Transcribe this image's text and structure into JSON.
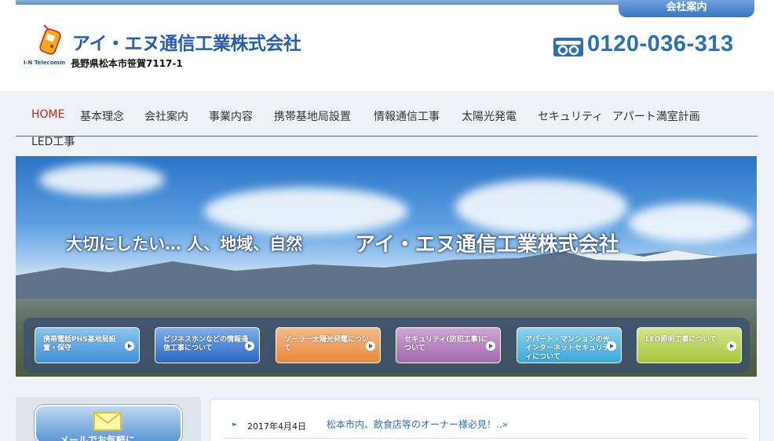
{
  "header": {
    "company_tab": "会社案内",
    "company_name": "アイ・エヌ通信工業株式会社",
    "brand_small": "I-N Telecomm",
    "address": "長野県松本市笹賀7117-1",
    "phone": "0120-036-313"
  },
  "nav": {
    "items": [
      "HOME",
      "基本理念",
      "会社案内",
      "事業内容",
      "携帯基地局設置",
      "情報通信工事",
      "太陽光発電",
      "セキュリティ",
      "アパート満室計画",
      "LED工事"
    ]
  },
  "hero": {
    "slogan": "大切にしたい… 人、地域、自然",
    "company": "アイ・エヌ通信工業株式会社",
    "services": [
      {
        "label": "携帯電話PHS基地局設置・保守",
        "color": "#3f8fd6"
      },
      {
        "label": "ビジネスホンなどの情報通信工事について",
        "color": "#2a66c4"
      },
      {
        "label": "ソーラー太陽光発電について",
        "color": "#e9873a"
      },
      {
        "label": "セキュリティ(防犯工事)について",
        "color": "#a06aae"
      },
      {
        "label": "アパート・マンションの光インターネットセキュリティについて",
        "color": "#39a9d9"
      },
      {
        "label": "LED照明工事について",
        "color": "#a7c63a"
      }
    ]
  },
  "sidebar": {
    "mail_label": "メールでお気軽に"
  },
  "news": {
    "date": "2017年4月4日",
    "text": "松本市内、飲食店等のオーナー様必見！..»"
  },
  "colors": {
    "brand": "#2a5db0",
    "accent": "#d0201a",
    "phone": "#2b6fb8"
  }
}
